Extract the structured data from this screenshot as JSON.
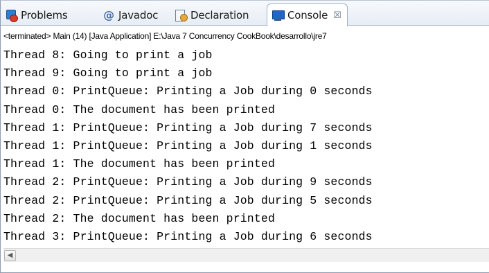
{
  "tabs": [
    {
      "label": "Problems",
      "icon": "problems-icon"
    },
    {
      "label": "Javadoc",
      "icon": "javadoc-icon"
    },
    {
      "label": "Declaration",
      "icon": "declaration-icon"
    },
    {
      "label": "Console",
      "icon": "console-icon",
      "close": "☒"
    }
  ],
  "status_line": "<terminated> Main (14) [Java Application] E:\\Java 7 Concurrency CookBook\\desarrollo\\jre7",
  "console_lines": [
    "Thread 8: Going to print a job",
    "Thread 9: Going to print a job",
    "Thread 0: PrintQueue: Printing a Job during 0 seconds",
    "Thread 0: The document has been printed",
    "Thread 1: PrintQueue: Printing a Job during 7 seconds",
    "Thread 1: PrintQueue: Printing a Job during 1 seconds",
    "Thread 1: The document has been printed",
    "Thread 2: PrintQueue: Printing a Job during 9 seconds",
    "Thread 2: PrintQueue: Printing a Job during 5 seconds",
    "Thread 2: The document has been printed",
    "Thread 3: PrintQueue: Printing a Job during 6 seconds"
  ],
  "scroll_left_glyph": "◀",
  "colors": {
    "active_tab_border": "#9fb0c6",
    "console_icon": "#1f66c8"
  }
}
